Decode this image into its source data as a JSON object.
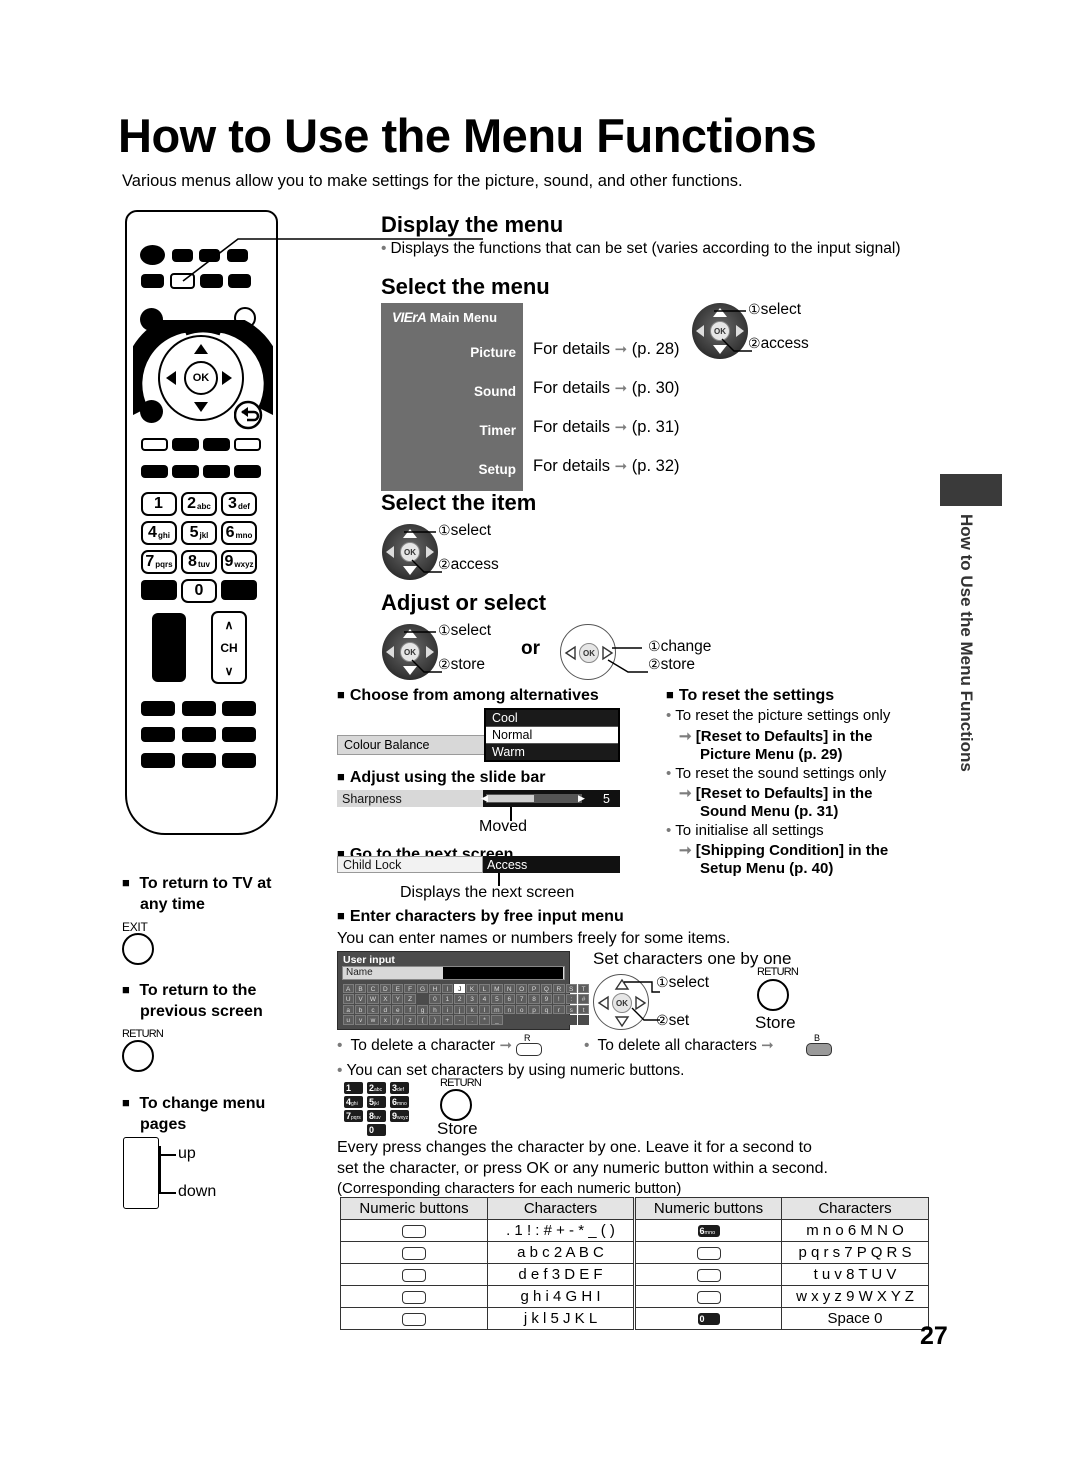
{
  "page": {
    "title": "How to Use the Menu Functions",
    "intro": "Various menus allow you to make settings for the picture, sound, and other functions.",
    "number": "27",
    "side_tab": "How to Use the Menu Functions"
  },
  "sections": {
    "display_menu": {
      "heading": "Display the menu",
      "note": "Displays the functions that can be set (varies according to the input signal)"
    },
    "select_menu": {
      "heading": "Select the menu",
      "brand": "VIErA",
      "panel_title": "Main Menu",
      "items": [
        {
          "label": "Picture",
          "detail": "For details",
          "page": "(p. 28)"
        },
        {
          "label": "Sound",
          "detail": "For details",
          "page": "(p. 30)"
        },
        {
          "label": "Timer",
          "detail": "For details",
          "page": "(p. 31)"
        },
        {
          "label": "Setup",
          "detail": "For details",
          "page": "(p. 32)"
        }
      ],
      "callout_1": "select",
      "callout_2": "access"
    },
    "select_item": {
      "heading": "Select the item",
      "callout_1": "select",
      "callout_2": "access"
    },
    "adjust_select": {
      "heading": "Adjust or select",
      "left_callout_1": "select",
      "left_callout_2": "store",
      "or": "or",
      "right_callout_1": "change",
      "right_callout_2": "store"
    }
  },
  "alternatives": {
    "heading": "Choose from among alternatives",
    "row_label": "Colour Balance",
    "options": [
      "Cool",
      "Normal",
      "Warm"
    ],
    "selected": "Normal"
  },
  "slide_bar": {
    "heading": "Adjust using the slide bar",
    "row_label": "Sharpness",
    "value": "5",
    "caption": "Moved"
  },
  "next_screen": {
    "heading": "Go to the next screen",
    "row_label": "Child Lock",
    "action": "Access",
    "caption": "Displays the next screen"
  },
  "reset": {
    "heading": "To reset the settings",
    "entries": [
      {
        "bullet": "To reset the picture settings only",
        "bold1": "[Reset to Defaults] in the",
        "bold2": "Picture Menu (p. 29)"
      },
      {
        "bullet": "To reset the sound settings only",
        "bold1": "[Reset to Defaults] in the",
        "bold2": "Sound Menu (p. 31)"
      },
      {
        "bullet": "To initialise all settings",
        "bold1": "[Shipping Condition] in the",
        "bold2": "Setup Menu (p. 40)"
      }
    ]
  },
  "free_input": {
    "heading": "Enter characters by free input menu",
    "intro": "You can enter names or numbers freely for some items.",
    "osd": {
      "title": "User input",
      "field_label": "Name",
      "keyboard_rows": [
        [
          "A",
          "B",
          "C",
          "D",
          "E",
          "F",
          "G",
          "H",
          "I",
          "J",
          "K",
          "L",
          "M",
          "N",
          "O",
          "P",
          "Q",
          "R",
          "S",
          "T"
        ],
        [
          "U",
          "V",
          "W",
          "X",
          "Y",
          "Z",
          "",
          "0",
          "1",
          "2",
          "3",
          "4",
          "5",
          "6",
          "7",
          "8",
          "9",
          "!",
          ":",
          "#"
        ],
        [
          "a",
          "b",
          "c",
          "d",
          "e",
          "f",
          "g",
          "h",
          "i",
          "j",
          "k",
          "l",
          "m",
          "n",
          "o",
          "p",
          "q",
          "r",
          "s",
          "t"
        ],
        [
          "u",
          "v",
          "w",
          "x",
          "y",
          "z",
          "(",
          ")",
          "+",
          "-",
          ".",
          "*",
          "_",
          "",
          "",
          "",
          "",
          "",
          "",
          ""
        ]
      ],
      "highlighted_key": "J"
    },
    "set_chars_title": "Set characters one by one",
    "callout_1": "select",
    "callout_2": "set",
    "return_label": "RETURN",
    "store_label": "Store",
    "delete_char": "To delete a character",
    "delete_char_key": "R",
    "delete_all": "To delete all characters",
    "delete_all_key": "B",
    "numeric_note": "You can set characters by using numeric buttons.",
    "numeric_return_label": "RETURN",
    "numeric_store_label": "Store",
    "explain_line_1": "Every press changes the character by one. Leave it for a second to",
    "explain_line_2": "set the character, or press OK or any numeric button within a second.",
    "explain_line_3": "(Corresponding characters for each numeric button)"
  },
  "char_table": {
    "headers": [
      "Numeric buttons",
      "Characters",
      "Numeric buttons",
      "Characters"
    ],
    "rows": [
      {
        "key_left": "",
        "key_left_style": "outline",
        "chars_left": ". 1 ! : # + - *  _ ( )",
        "key_right": "6",
        "key_right_sub": "mno",
        "key_right_style": "dark",
        "chars_right": "m n o 6 M N O"
      },
      {
        "key_left": "",
        "key_left_style": "outline",
        "chars_left": "a b c 2 A B C",
        "key_right": "",
        "key_right_sub": "",
        "key_right_style": "outline",
        "chars_right": "p q r s 7 P Q R S"
      },
      {
        "key_left": "",
        "key_left_style": "outline",
        "chars_left": "d e f 3 D E F",
        "key_right": "",
        "key_right_sub": "",
        "key_right_style": "outline",
        "chars_right": "t u v 8 T U V"
      },
      {
        "key_left": "",
        "key_left_style": "outline",
        "chars_left": "g h i 4 G H I",
        "key_right": "",
        "key_right_sub": "",
        "key_right_style": "outline",
        "chars_right": "w x y z 9 W X Y Z"
      },
      {
        "key_left": "",
        "key_left_style": "outline",
        "chars_left": "j k l 5 J K L",
        "key_right": "0",
        "key_right_sub": "",
        "key_right_style": "dark",
        "chars_right": "Space 0"
      }
    ]
  },
  "left_notes": {
    "return_tv": {
      "line1": "To return to TV at",
      "line2": "any time",
      "button": "EXIT"
    },
    "return_prev": {
      "line1": "To return to the",
      "line2": "previous screen",
      "button": "RETURN"
    },
    "change_pages": {
      "line1": "To change menu",
      "line2": "pages",
      "up": "up",
      "down": "down"
    }
  },
  "remote_keys": {
    "numeric": [
      {
        "num": "1",
        "sub": ""
      },
      {
        "num": "2",
        "sub": "abc"
      },
      {
        "num": "3",
        "sub": "def"
      },
      {
        "num": "4",
        "sub": "ghi"
      },
      {
        "num": "5",
        "sub": "jkl"
      },
      {
        "num": "6",
        "sub": "mno"
      },
      {
        "num": "7",
        "sub": "pqrs"
      },
      {
        "num": "8",
        "sub": "tuv"
      },
      {
        "num": "9",
        "sub": "wxyz"
      },
      {
        "num": "0",
        "sub": ""
      }
    ],
    "ok": "OK",
    "ch": "CH"
  },
  "colors": {
    "panel_grey": "#6e6e6e",
    "osd_label": "#d8d8d8",
    "osd_dark": "#111111",
    "tab_dark": "#3a3a3a"
  }
}
